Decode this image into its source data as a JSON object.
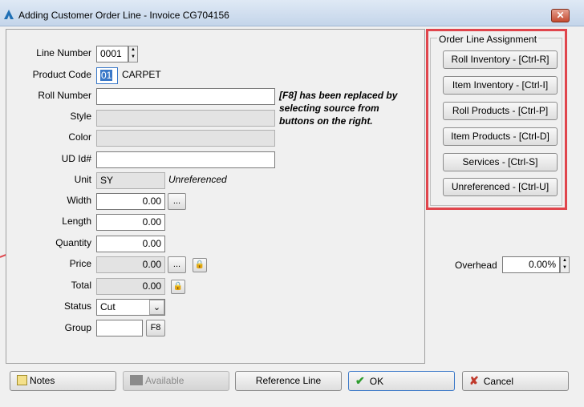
{
  "window": {
    "title": "Adding Customer Order Line - Invoice CG704156",
    "close_glyph": "✕"
  },
  "fields": {
    "line_number": {
      "label": "Line Number",
      "value": "0001"
    },
    "product_code": {
      "label": "Product Code",
      "value": "01",
      "desc": "CARPET"
    },
    "roll_number": {
      "label": "Roll Number",
      "value": ""
    },
    "style": {
      "label": "Style",
      "value": ""
    },
    "color": {
      "label": "Color",
      "value": ""
    },
    "ud_id": {
      "label": "UD Id#",
      "value": ""
    },
    "unit": {
      "label": "Unit",
      "value": "SY",
      "note": "Unreferenced"
    },
    "width": {
      "label": "Width",
      "value": "0.00"
    },
    "length": {
      "label": "Length",
      "value": "0.00"
    },
    "quantity": {
      "label": "Quantity",
      "value": "0.00"
    },
    "price": {
      "label": "Price",
      "value": "0.00"
    },
    "total": {
      "label": "Total",
      "value": "0.00"
    },
    "status": {
      "label": "Status",
      "value": "Cut"
    },
    "group": {
      "label": "Group",
      "value": "",
      "button": "F8"
    }
  },
  "f8_note": "[F8] has been replaced by selecting source from buttons on the right.",
  "ellipsis": "...",
  "assignment": {
    "title": "Order Line Assignment",
    "buttons": [
      "Roll Inventory - [Ctrl-R]",
      "Item Inventory - [Ctrl-I]",
      "Roll Products - [Ctrl-P]",
      "Item Products - [Ctrl-D]",
      "Services - [Ctrl-S]",
      "Unreferenced - [Ctrl-U]"
    ]
  },
  "overhead": {
    "label": "Overhead",
    "value": "0.00%"
  },
  "bottom": {
    "notes": "Notes",
    "available": "Available",
    "reference_line": "Reference Line",
    "ok": "OK",
    "cancel": "Cancel"
  },
  "colors": {
    "highlight": "#e0454c",
    "ok_check": "#2e9c2e",
    "cancel_x": "#c0392b"
  }
}
